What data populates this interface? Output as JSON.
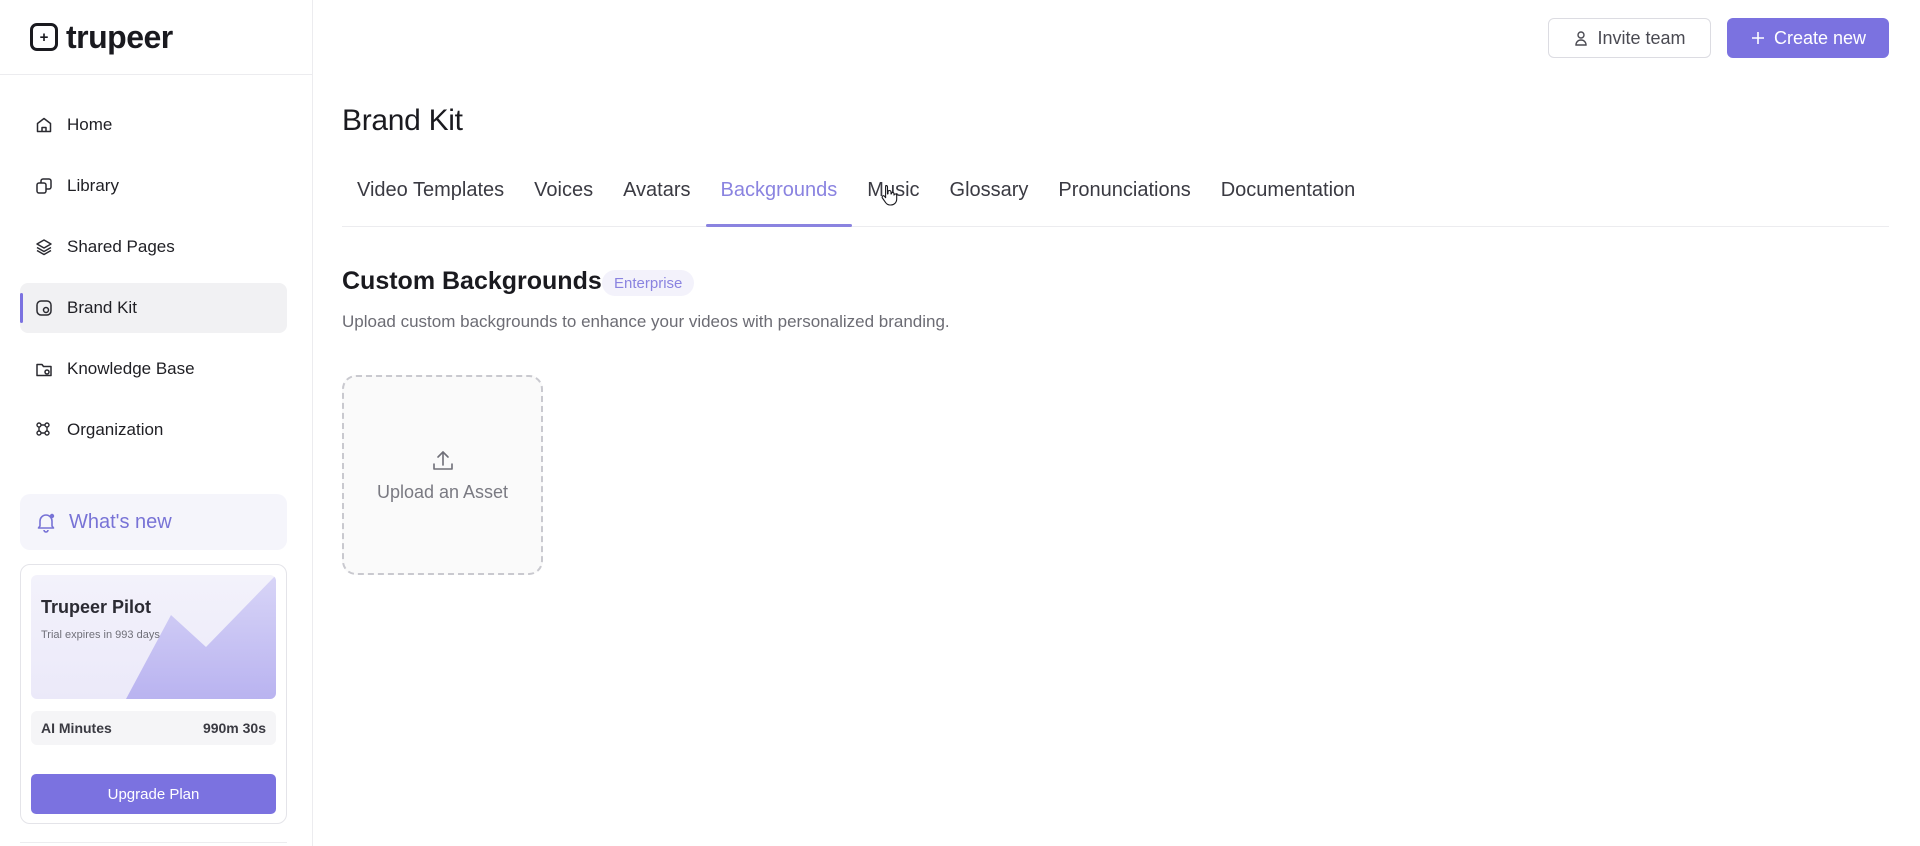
{
  "logo": {
    "text": "trupeer"
  },
  "sidebar": {
    "items": [
      {
        "label": "Home",
        "icon": "home-icon"
      },
      {
        "label": "Library",
        "icon": "library-icon"
      },
      {
        "label": "Shared Pages",
        "icon": "layers-icon"
      },
      {
        "label": "Brand Kit",
        "icon": "brand-kit-icon",
        "active": true
      },
      {
        "label": "Knowledge Base",
        "icon": "folder-icon"
      },
      {
        "label": "Organization",
        "icon": "organization-icon"
      }
    ],
    "whats_new": "What's new",
    "plan": {
      "title": "Trupeer Pilot",
      "subtitle": "Trial expires in 993 days",
      "minutes_label": "AI Minutes",
      "minutes_value": "990m 30s",
      "upgrade_label": "Upgrade Plan"
    }
  },
  "header": {
    "invite_label": "Invite team",
    "create_label": "Create new"
  },
  "main": {
    "title": "Brand Kit",
    "tabs": [
      {
        "label": "Video Templates"
      },
      {
        "label": "Voices"
      },
      {
        "label": "Avatars"
      },
      {
        "label": "Backgrounds",
        "active": true
      },
      {
        "label": "Music"
      },
      {
        "label": "Glossary"
      },
      {
        "label": "Pronunciations"
      },
      {
        "label": "Documentation"
      }
    ],
    "section_title": "Custom Backgrounds",
    "badge": "Enterprise",
    "description": "Upload custom backgrounds to enhance your videos with personalized branding.",
    "upload_label": "Upload an Asset"
  },
  "colors": {
    "accent": "#7b72e0",
    "accent_text": "#8a83e0",
    "active_bg": "#f1f1f3"
  }
}
